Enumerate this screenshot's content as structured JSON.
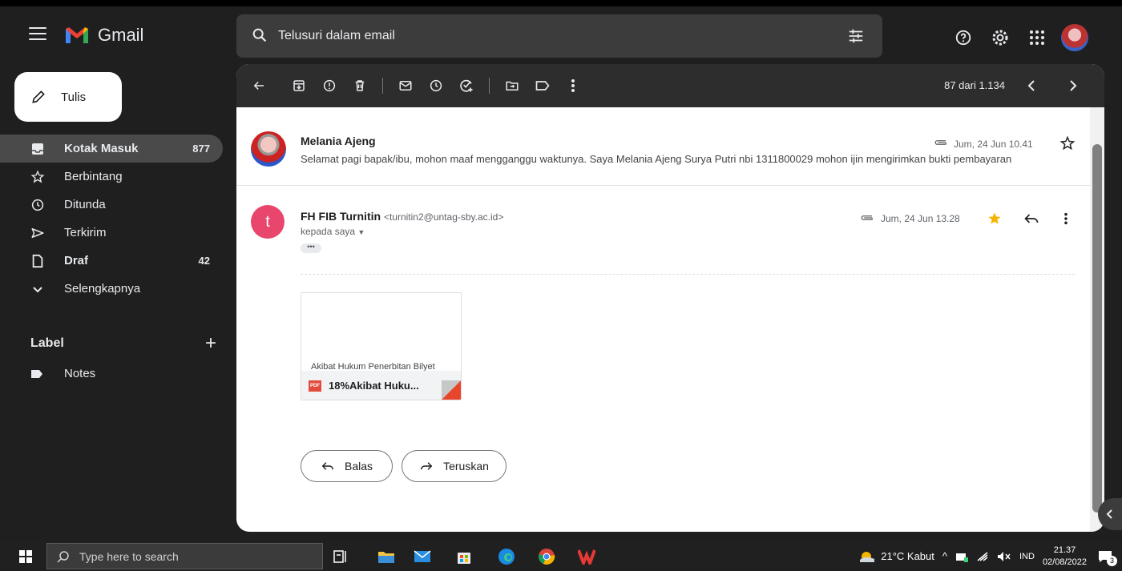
{
  "app": {
    "name": "Gmail"
  },
  "search": {
    "placeholder": "Telusuri dalam email"
  },
  "compose": {
    "label": "Tulis"
  },
  "sidebar": {
    "items": [
      {
        "label": "Kotak Masuk",
        "count": "877",
        "icon": "inbox-icon",
        "active": true
      },
      {
        "label": "Berbintang",
        "count": "",
        "icon": "star-icon"
      },
      {
        "label": "Ditunda",
        "count": "",
        "icon": "clock-icon"
      },
      {
        "label": "Terkirim",
        "count": "",
        "icon": "send-icon"
      },
      {
        "label": "Draf",
        "count": "42",
        "icon": "draft-icon"
      },
      {
        "label": "Selengkapnya",
        "count": "",
        "icon": "chevron-down-icon"
      }
    ],
    "labels_heading": "Label",
    "labels": [
      {
        "label": "Notes",
        "icon": "label-icon"
      }
    ]
  },
  "toolbar": {
    "pager": "87 dari 1.134"
  },
  "messages": [
    {
      "sender": "Melania Ajeng",
      "date": "Jum, 24 Jun 10.41",
      "snippet": "Selamat pagi bapak/ibu, mohon maaf mengganggu waktunya. Saya Melania Ajeng Surya Putri nbi 1311800029 mohon ijin mengirimkan bukti pembayaran"
    },
    {
      "sender": "FH FIB Turnitin",
      "email": "<turnitin2@untag-sby.ac.id>",
      "avatar_letter": "t",
      "date": "Jum, 24 Jun 13.28",
      "to": "kepada saya",
      "trimmed": "•••",
      "attachment": {
        "preview_text": "Akibat Hukum Penerbitan Bilyet",
        "badge": "PDF",
        "name": "18%Akibat Huku..."
      }
    }
  ],
  "actions": {
    "reply": "Balas",
    "forward": "Teruskan"
  },
  "taskbar": {
    "search_placeholder": "Type here to search",
    "weather": "21°C  Kabut",
    "lang": "IND",
    "time": "21.37",
    "date": "02/08/2022",
    "notif_count": "3"
  },
  "colors": {
    "accent_red": "#e34a3a",
    "avatar_pink": "#e8466d",
    "star_yellow": "#f4b400"
  }
}
